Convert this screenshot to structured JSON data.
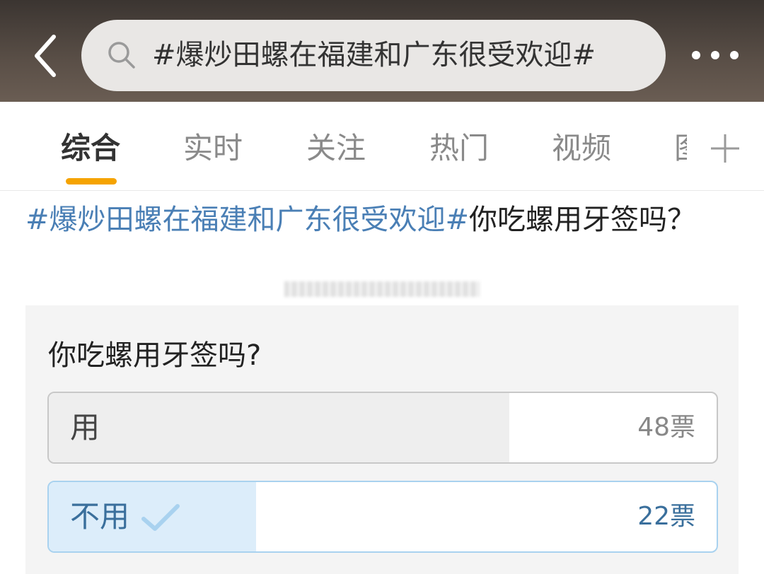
{
  "header": {
    "search_text": "#爆炒田螺在福建和广东很受欢迎#"
  },
  "tabs": [
    {
      "label": "综合",
      "active": true
    },
    {
      "label": "实时",
      "active": false
    },
    {
      "label": "关注",
      "active": false
    },
    {
      "label": "热门",
      "active": false
    },
    {
      "label": "视频",
      "active": false
    },
    {
      "label": "图",
      "active": false
    }
  ],
  "post": {
    "topic": "#爆炒田螺在福建和广东很受欢迎#",
    "text": "你吃螺用牙签吗？"
  },
  "poll": {
    "question": "你吃螺用牙签吗?",
    "options": [
      {
        "label": "用",
        "votes_text": "48票",
        "votes": 48,
        "fill_fraction": 0.69,
        "selected": false
      },
      {
        "label": "不用",
        "votes_text": "22票",
        "votes": 22,
        "fill_fraction": 0.31,
        "selected": true
      }
    ]
  },
  "icons": {
    "back": "chevron-left-icon",
    "search": "search-icon",
    "more": "more-horizontal-icon",
    "add": "plus-icon",
    "selected": "check-icon"
  },
  "colors": {
    "accent": "#f5a300",
    "topic_link": "#4a7fb5",
    "selected_option_fill": "#dcedfa",
    "selected_option_border": "#a9d2ef",
    "check": "#a9d2ef"
  }
}
